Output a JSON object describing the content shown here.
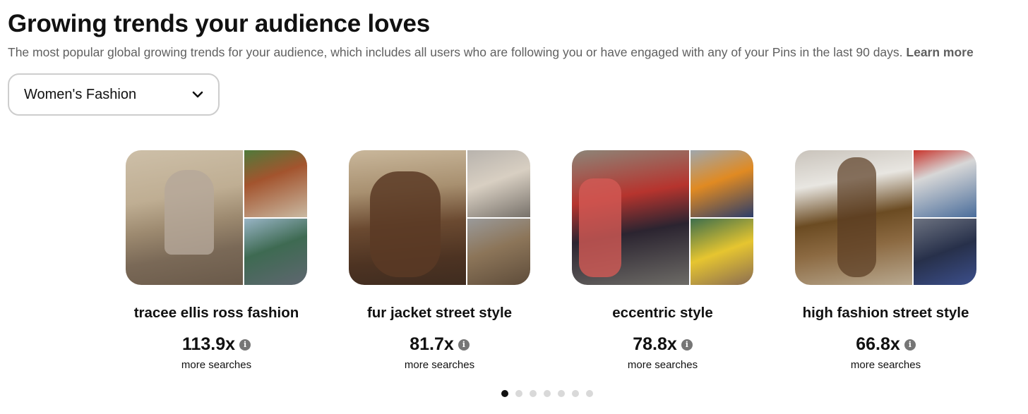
{
  "header": {
    "title": "Growing trends your audience loves",
    "subtitle": "The most popular global growing trends for your audience, which includes all users who are following you or have engaged with any of your Pins in the last 90 days.",
    "learn_more": "Learn more"
  },
  "filter": {
    "selected": "Women's Fashion",
    "icon": "chevron-down-icon"
  },
  "trends": [
    {
      "title": "tracee ellis ross fashion",
      "value": "113.9x",
      "label": "more searches"
    },
    {
      "title": "fur jacket street style",
      "value": "81.7x",
      "label": "more searches"
    },
    {
      "title": "eccentric style",
      "value": "78.8x",
      "label": "more searches"
    },
    {
      "title": "high fashion street style",
      "value": "66.8x",
      "label": "more searches"
    }
  ],
  "info_icon_glyph": "i",
  "pagination": {
    "total": 7,
    "active_index": 0
  },
  "colors": {
    "text": "#111111",
    "muted": "#5f5f5f",
    "border": "#cdcdcd",
    "dot_inactive": "#d9d9d9",
    "dot_active": "#111111"
  }
}
